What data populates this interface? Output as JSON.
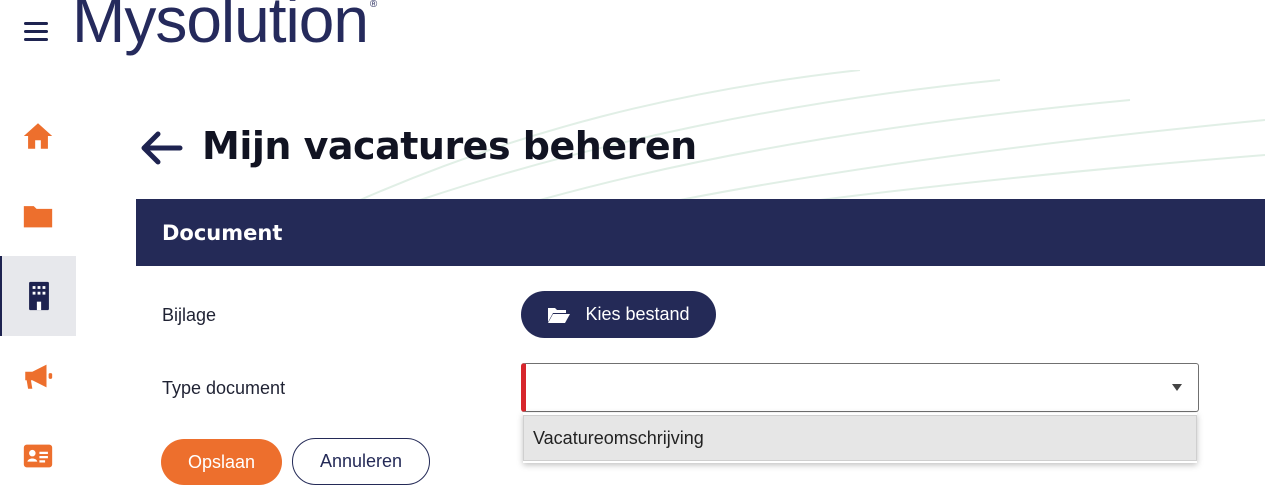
{
  "app": {
    "brand": "Mysolution",
    "brand_mark": "®"
  },
  "header": {
    "title": "Mijn vacatures beheren"
  },
  "sidebar": {
    "items": [
      {
        "icon": "home-icon"
      },
      {
        "icon": "folder-icon"
      },
      {
        "icon": "building-icon",
        "active": true
      },
      {
        "icon": "megaphone-icon"
      },
      {
        "icon": "id-card-icon"
      }
    ],
    "accent_color": "#ed6f2d",
    "active_color": "#1e2350"
  },
  "card": {
    "title": "Document",
    "attachment_label": "Bijlage",
    "file_button_label": "Kies bestand",
    "type_label": "Type document",
    "type_value": "",
    "dropdown_options": [
      "Vacatureomschrijving"
    ]
  },
  "actions": {
    "save_label": "Opslaan",
    "cancel_label": "Annuleren"
  },
  "colors": {
    "navy": "#242a57",
    "orange": "#ed6f2d",
    "required": "#d7262c"
  }
}
